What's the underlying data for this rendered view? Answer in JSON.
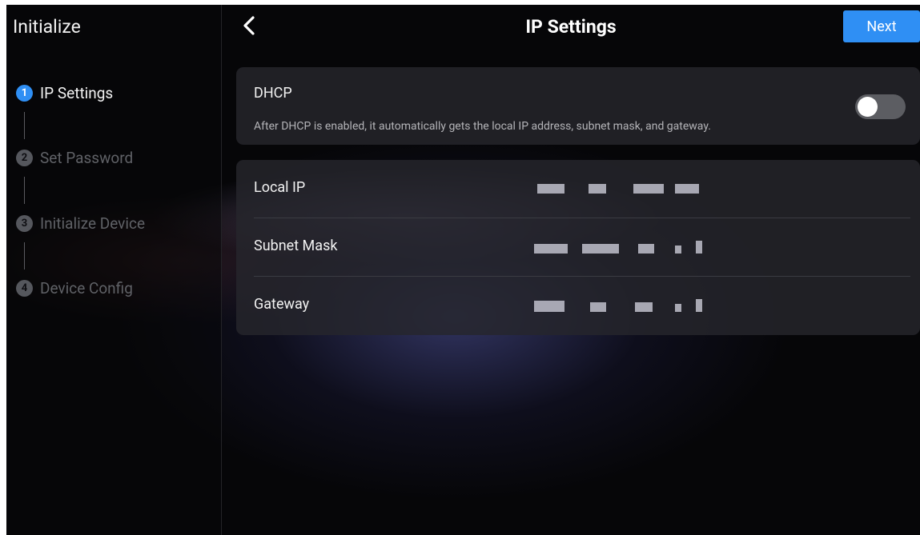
{
  "sidebar": {
    "title": "Initialize",
    "steps": [
      {
        "num": "1",
        "label": "IP Settings",
        "active": true
      },
      {
        "num": "2",
        "label": "Set Password",
        "active": false
      },
      {
        "num": "3",
        "label": "Initialize Device",
        "active": false
      },
      {
        "num": "4",
        "label": "Device Config",
        "active": false
      }
    ]
  },
  "header": {
    "back_icon": "chevron-left-icon",
    "title": "IP Settings",
    "next_label": "Next"
  },
  "dhcp": {
    "title": "DHCP",
    "description": "After DHCP is enabled, it automatically gets the local IP address, subnet mask, and gateway.",
    "enabled": false
  },
  "network": {
    "rows": [
      {
        "label": "Local IP"
      },
      {
        "label": "Subnet Mask"
      },
      {
        "label": "Gateway"
      }
    ]
  },
  "colors": {
    "accent": "#2f8ff4",
    "background": "#060608",
    "card": "#26262c",
    "inactive_text": "#5f6166"
  }
}
